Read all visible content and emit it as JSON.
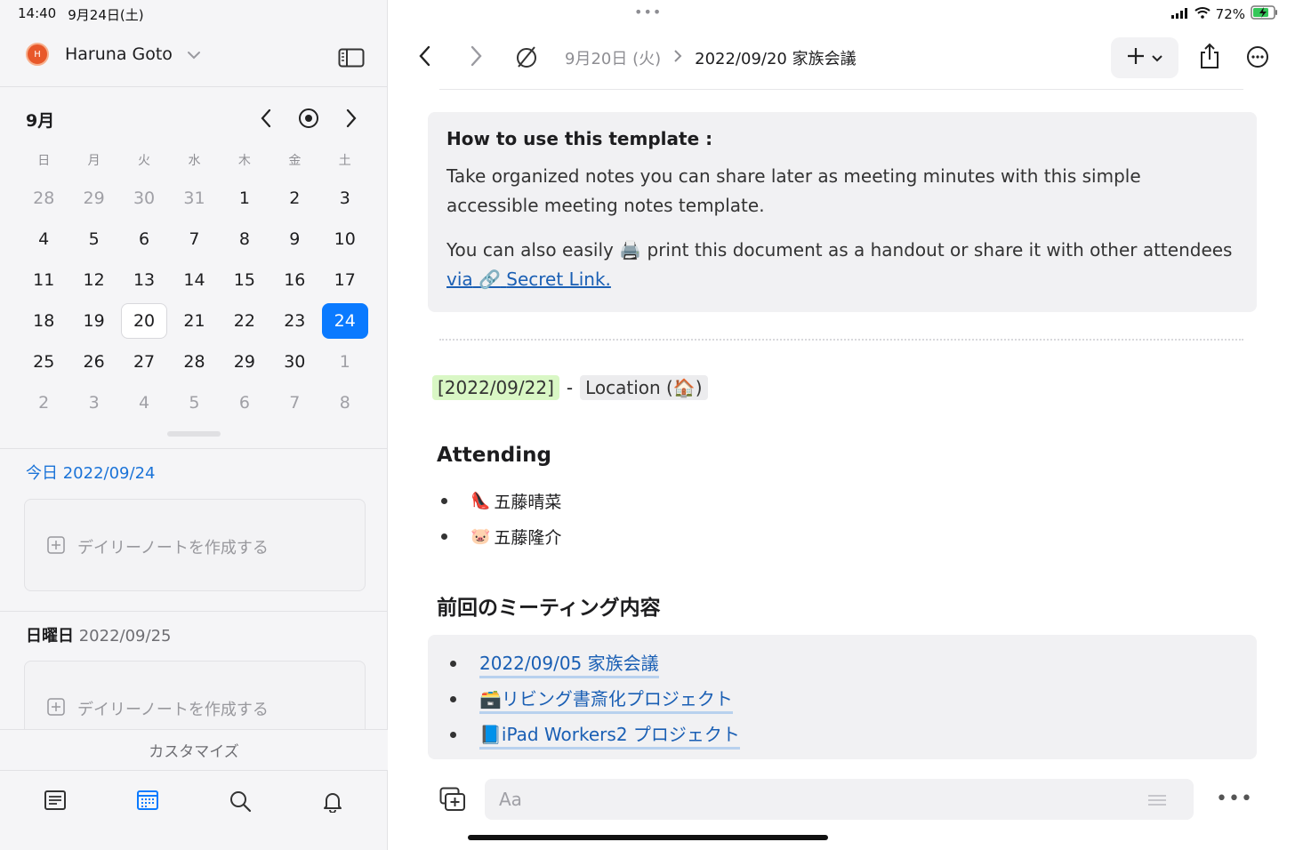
{
  "status": {
    "time": "14:40",
    "date": "9月24日(土)",
    "battery": "72%"
  },
  "sidebar": {
    "user_initial": "H",
    "user_name": "Haruna Goto",
    "calendar": {
      "month": "9月",
      "weekdays": [
        "日",
        "月",
        "火",
        "水",
        "木",
        "金",
        "土"
      ],
      "weeks": [
        [
          "28",
          "29",
          "30",
          "31",
          "1",
          "2",
          "3"
        ],
        [
          "4",
          "5",
          "6",
          "7",
          "8",
          "9",
          "10"
        ],
        [
          "11",
          "12",
          "13",
          "14",
          "15",
          "16",
          "17"
        ],
        [
          "18",
          "19",
          "20",
          "21",
          "22",
          "23",
          "24"
        ],
        [
          "25",
          "26",
          "27",
          "28",
          "29",
          "30",
          "1"
        ],
        [
          "2",
          "3",
          "4",
          "5",
          "6",
          "7",
          "8"
        ]
      ],
      "selected_day": "24",
      "highlighted_day": "20"
    },
    "today_heading_prefix": "今日",
    "today_heading_date": "2022/09/24",
    "create_daily_note": "デイリーノートを作成する",
    "sunday_heading_prefix": "日曜日",
    "sunday_heading_date": "2022/09/25",
    "customize": "カスタマイズ"
  },
  "header": {
    "parent_crumb": "9月20日 (火)",
    "current_crumb": "2022/09/20 家族会議"
  },
  "document": {
    "callout_title": "How to use this template :",
    "callout_p1": "Take organized notes you can share later as meeting minutes with this simple accessible meeting notes template.",
    "callout_p2_a": "You can also easily",
    "callout_p2_emoji": "🖨️",
    "callout_p2_b": "print this document as a handout or share it with other attendees",
    "callout_link_via": "via",
    "callout_link_emoji": "🔗",
    "callout_link_text": "Secret Link.",
    "meta_date": "[2022/09/22]",
    "meta_sep": "-",
    "meta_location": "Location (🏠)",
    "attending_heading": "Attending",
    "attendees": [
      {
        "emoji": "👠",
        "name": "五藤晴菜"
      },
      {
        "emoji": "🐷",
        "name": "五藤隆介"
      }
    ],
    "previous_heading": "前回のミーティング内容",
    "previous_links": [
      {
        "emoji": "",
        "text": "2022/09/05 家族会議"
      },
      {
        "emoji": "🗃️",
        "text": "リビング書斎化プロジェクト"
      },
      {
        "emoji": "📘",
        "text": "iPad Workers2 プロジェクト"
      }
    ]
  },
  "composer": {
    "placeholder": "Aa"
  },
  "colors": {
    "accent": "#0a7aff",
    "link": "#1a5fb4",
    "date_tag": "#d9f7c5"
  }
}
